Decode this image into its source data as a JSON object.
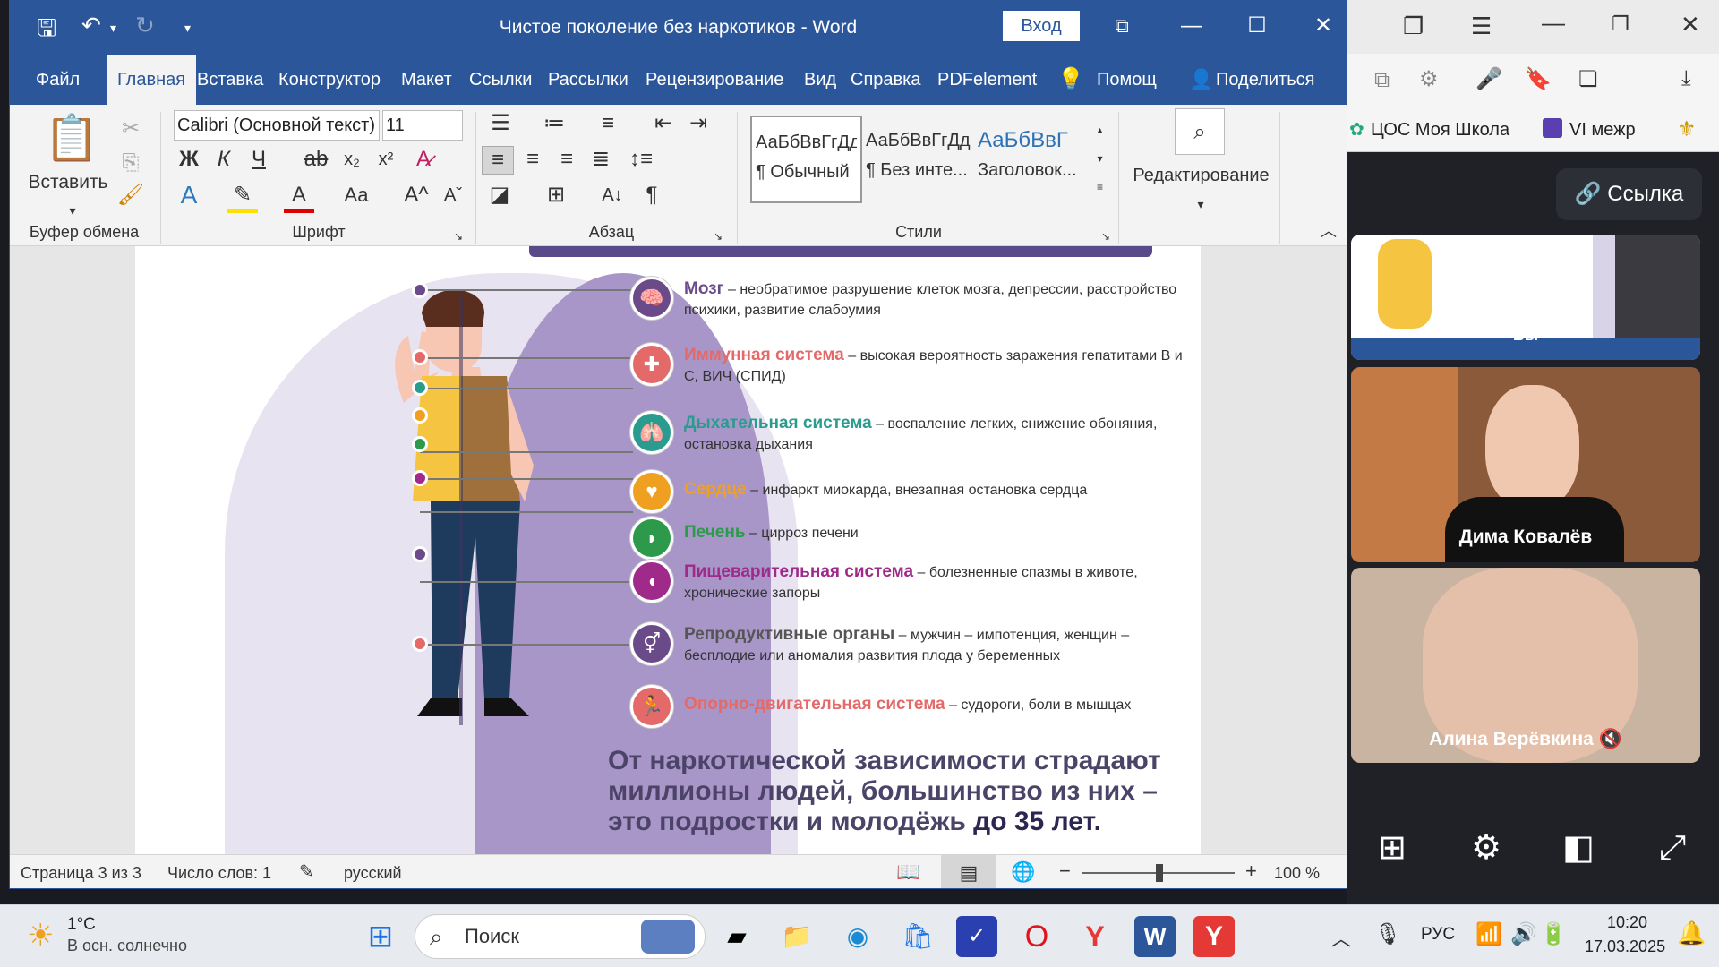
{
  "word": {
    "title": "Чистое поколение без наркотиков  -  Word",
    "signin_label": "Вход",
    "tabs": [
      "Файл",
      "Главная",
      "Вставка",
      "Конструктор",
      "Макет",
      "Ссылки",
      "Рассылки",
      "Рецензирование",
      "Вид",
      "Справка",
      "PDFelement",
      "Помощ",
      "Поделиться"
    ],
    "active_tab": "Главная",
    "ribbon": {
      "paste_label": "Вставить",
      "clipboard_group": "Буфер обмена",
      "font_name": "Calibri (Основной текст)",
      "font_size": "11",
      "font_group": "Шрифт",
      "paragraph_group": "Абзац",
      "styles_group": "Стили",
      "styles": [
        {
          "sample": "АаБбВвГгДд",
          "name": "¶ Обычный"
        },
        {
          "sample": "АаБбВвГгДд",
          "name": "¶ Без инте..."
        },
        {
          "sample": "АаБбВвГ",
          "name": "Заголовок..."
        }
      ],
      "editing_label": "Редактирование"
    },
    "infographic": {
      "organs": [
        {
          "name": "Мозг",
          "desc": " – необратимое разрушение клеток мозга, депрессии, расстройство психики, развитие слабоумия",
          "color": "#6b4a8a"
        },
        {
          "name": "Иммунная система",
          "desc": " – высокая вероятность заражения гепатитами В и С, ВИЧ (СПИД)",
          "color": "#e46a6a"
        },
        {
          "name": "Дыхательная система",
          "desc": " – воспаление легких, снижение обоняния, остановка дыхания",
          "color": "#2a9c8f"
        },
        {
          "name": "Сердце",
          "desc": " – инфаркт миокарда, внезапная остановка сердца",
          "color": "#f0a020"
        },
        {
          "name": "Печень",
          "desc": " – цирроз печени",
          "color": "#2c9a4a"
        },
        {
          "name": "Пищеварительная система",
          "desc": " – болезненные спазмы в животе, хронические запоры",
          "color": "#a02a8a"
        },
        {
          "name": "Репродуктивные органы",
          "desc": " – мужчин – импотенция, женщин – бесплодие или аномалия развития плода у беременных",
          "color": "#6b4a8a"
        },
        {
          "name": "Опорно-двигательная система",
          "desc": " – судороги, боли в мышцах",
          "color": "#e46a6a"
        }
      ],
      "conclusion_a": "От наркотической зависимости страдают миллионы людей, большинство из них – это подростки и молодёжь ",
      "conclusion_b": "до 35 лет."
    },
    "status": {
      "page": "Страница 3 из 3",
      "words": "Число слов: 1",
      "language": "русский",
      "zoom": "100 %"
    }
  },
  "browser": {
    "bookmark1": "ЦОС Моя Школа",
    "bookmark2": "VI межр",
    "link_button": "Ссылка",
    "self_label": "Вы",
    "participants": [
      "Дима Ковалёв",
      "Алина Верёвкина"
    ]
  },
  "taskbar": {
    "weather_temp": "1°C",
    "weather_desc": "В осн. солнечно",
    "search_placeholder": "Поиск",
    "lang": "РУС",
    "time": "10:20",
    "date": "17.03.2025"
  }
}
